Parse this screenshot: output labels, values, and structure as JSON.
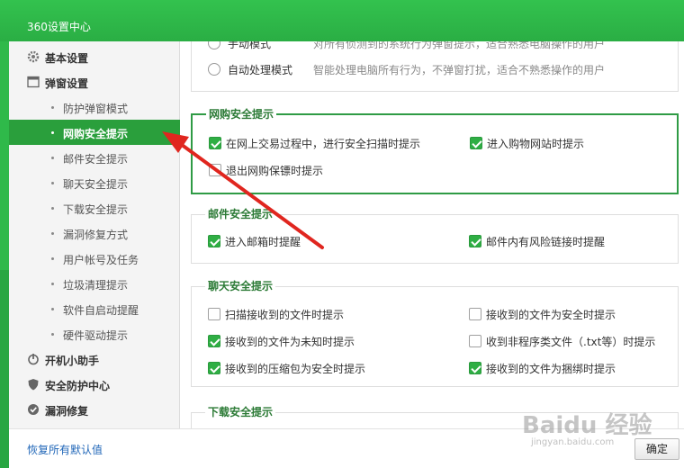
{
  "window": {
    "title": "360设置中心"
  },
  "sidebar": {
    "sections": [
      {
        "label": "基本设置",
        "icon": "gear-icon"
      },
      {
        "label": "弹窗设置",
        "icon": "window-icon"
      }
    ],
    "sub_items": [
      "防护弹窗模式",
      "网购安全提示",
      "邮件安全提示",
      "聊天安全提示",
      "下载安全提示",
      "漏洞修复方式",
      "用户帐号及任务",
      "垃圾清理提示",
      "软件自启动提醒",
      "硬件驱动提示"
    ],
    "active_item": "网购安全提示",
    "bottom_sections": [
      {
        "label": "开机小助手",
        "icon": "power-icon"
      },
      {
        "label": "安全防护中心",
        "icon": "shield-icon"
      },
      {
        "label": "漏洞修复",
        "icon": "patch-icon"
      }
    ]
  },
  "popup_mode": {
    "options": [
      {
        "label": "手动模式",
        "desc": "对所有侦测到的系统行为弹窗提示，适合熟悉电脑操作的用户",
        "selected": false
      },
      {
        "label": "自动处理模式",
        "desc": "智能处理电脑所有行为，不弹窗打扰，适合不熟悉操作的用户",
        "selected": false
      }
    ]
  },
  "shopping": {
    "title": "网购安全提示",
    "items": [
      {
        "label": "在网上交易过程中，进行安全扫描时提示",
        "checked": true
      },
      {
        "label": "进入购物网站时提示",
        "checked": true
      },
      {
        "label": "退出网购保镖时提示",
        "checked": false
      }
    ]
  },
  "mail": {
    "title": "邮件安全提示",
    "items": [
      {
        "label": "进入邮箱时提醒",
        "checked": true
      },
      {
        "label": "邮件内有风险链接时提醒",
        "checked": true
      }
    ]
  },
  "chat": {
    "title": "聊天安全提示",
    "items": [
      {
        "label": "扫描接收到的文件时提示",
        "checked": false
      },
      {
        "label": "接收到的文件为安全时提示",
        "checked": false
      },
      {
        "label": "接收到的文件为未知时提示",
        "checked": true
      },
      {
        "label": "收到非程序类文件（.txt等）时提示",
        "checked": false
      },
      {
        "label": "接收到的压缩包为安全时提示",
        "checked": true
      },
      {
        "label": "接收到的文件为捆绑时提示",
        "checked": true
      }
    ]
  },
  "download": {
    "title": "下载安全提示"
  },
  "footer": {
    "restore_label": "恢复所有默认值",
    "ok_label": "确定"
  },
  "watermark": {
    "text": "Baidu 经验",
    "sub": "jingyan.baidu.com"
  },
  "colors": {
    "accent": "#2a9f3c",
    "checkbox": "#2fae44",
    "link": "#2167b8"
  }
}
